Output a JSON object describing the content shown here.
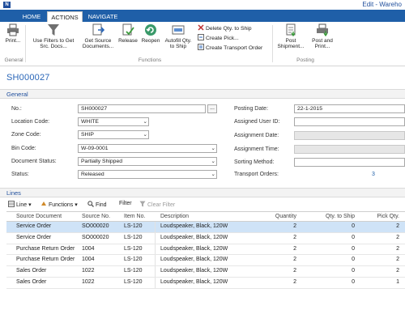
{
  "window": {
    "title": "Edit - Wareho"
  },
  "ribbon": {
    "tabs": [
      "HOME",
      "ACTIONS",
      "NAVIGATE"
    ],
    "buttons": {
      "print": "Print...",
      "use_filters": [
        "Use Filters to Get",
        "Src. Docs..."
      ],
      "get_source": [
        "Get Source",
        "Documents..."
      ],
      "release": "Release",
      "reopen": "Reopen",
      "autofill": [
        "Autofill Qty.",
        "to Ship"
      ],
      "delete_qty": "Delete Qty. to Ship",
      "create_pick": "Create Pick...",
      "create_transport": "Create Transport Order",
      "post_shipment": [
        "Post",
        "Shipment..."
      ],
      "post_print": [
        "Post and",
        "Print..."
      ]
    },
    "groups": {
      "general": "General",
      "functions": "Functions",
      "posting": "Posting"
    }
  },
  "page_title": "SH000027",
  "general": {
    "section_title": "General",
    "fields": {
      "no_label": "No.:",
      "no_value": "SH000027",
      "location_label": "Location Code:",
      "location_value": "WHITE",
      "zone_label": "Zone Code:",
      "zone_value": "SHIP",
      "bin_label": "Bin Code:",
      "bin_value": "W-09-0001",
      "doc_status_label": "Document Status:",
      "doc_status_value": "Partially Shipped",
      "status_label": "Status:",
      "status_value": "Released",
      "posting_date_label": "Posting Date:",
      "posting_date_value": "22-1-2015",
      "assigned_user_label": "Assigned User ID:",
      "assignment_date_label": "Assignment Date:",
      "assignment_time_label": "Assignment Time:",
      "sorting_label": "Sorting Method:",
      "transport_label": "Transport Orders:",
      "transport_value": "3"
    }
  },
  "lines": {
    "section_title": "Lines",
    "toolbar": {
      "line": "Line",
      "functions": "Functions",
      "find": "Find",
      "filter": "Filter",
      "clear_filter": "Clear Filter"
    },
    "columns": [
      "Source Document",
      "Source No.",
      "Item No.",
      "Description",
      "Quantity",
      "Qty. to Ship",
      "Pick Qty."
    ],
    "rows": [
      {
        "source_document": "Service Order",
        "source_no": "SO000020",
        "item_no": "LS-120",
        "description": "Loudspeaker, Black, 120W",
        "quantity": "2",
        "qty_to_ship": "0",
        "pick_qty": "2"
      },
      {
        "source_document": "Service Order",
        "source_no": "SO000020",
        "item_no": "LS-120",
        "description": "Loudspeaker, Black, 120W",
        "quantity": "2",
        "qty_to_ship": "0",
        "pick_qty": "2"
      },
      {
        "source_document": "Purchase Return Order",
        "source_no": "1004",
        "item_no": "LS-120",
        "description": "Loudspeaker, Black, 120W",
        "quantity": "2",
        "qty_to_ship": "0",
        "pick_qty": "2"
      },
      {
        "source_document": "Purchase Return Order",
        "source_no": "1004",
        "item_no": "LS-120",
        "description": "Loudspeaker, Black, 120W",
        "quantity": "2",
        "qty_to_ship": "0",
        "pick_qty": "2"
      },
      {
        "source_document": "Sales Order",
        "source_no": "1022",
        "item_no": "LS-120",
        "description": "Loudspeaker, Black, 120W",
        "quantity": "2",
        "qty_to_ship": "0",
        "pick_qty": "2"
      },
      {
        "source_document": "Sales Order",
        "source_no": "1022",
        "item_no": "LS-120",
        "description": "Loudspeaker, Black, 120W",
        "quantity": "2",
        "qty_to_ship": "0",
        "pick_qty": "1"
      }
    ]
  },
  "colors": {
    "accent": "#1f5fa8",
    "title_blue": "#2a66b8",
    "selected_row": "#cfe3f7"
  },
  "icons": [
    "app-icon",
    "print-icon",
    "filter-icon",
    "get-source-icon",
    "release-icon",
    "reopen-icon",
    "autofill-icon",
    "delete-icon",
    "create-pick-icon",
    "create-transport-icon",
    "post-shipment-icon",
    "post-print-icon",
    "line-icon",
    "functions-icon",
    "find-icon",
    "filter-icon",
    "clear-filter-icon"
  ]
}
